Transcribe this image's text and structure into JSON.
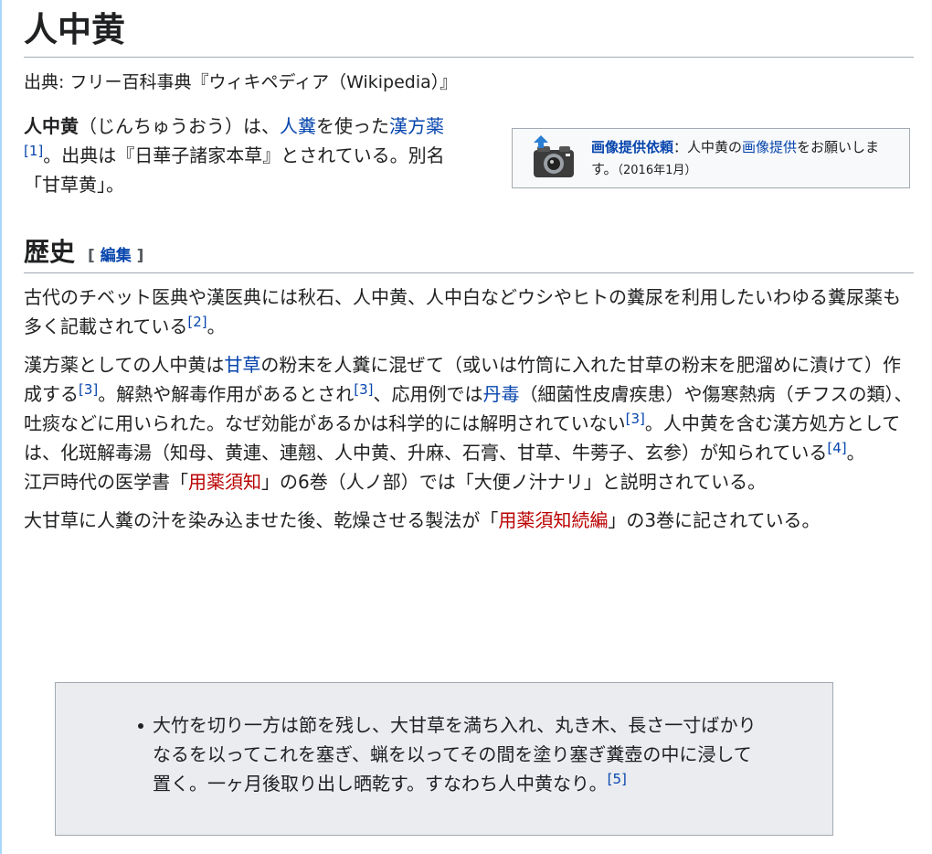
{
  "page_title": "人中黄",
  "subtitle": "出典: フリー百科事典『ウィキペディア（Wikipedia）』",
  "lead": {
    "term": "人中黄",
    "t1": "（じんちゅうおう）は、",
    "link_jinpun": "人糞",
    "t2": "を使った",
    "link_kampo": "漢方薬",
    "ref1": "[1]",
    "t3": "。出典は『日華子諸家本草』とされている。別名「甘草黄」。"
  },
  "ambox": {
    "camera_icon": "camera-upload-icon",
    "title": "画像提供依頼",
    "t1": "：人中黄の",
    "link": "画像提供",
    "t2": "をお願いします。",
    "date": "（2016年1月）"
  },
  "history": {
    "heading": "歴史",
    "edit_open": "[ ",
    "edit_label": "編集",
    "edit_close": " ]",
    "p1": {
      "text": "古代のチベット医典や漢医典には秋石、人中黄、人中白などウシやヒトの糞尿を利用したいわゆる糞尿薬も多く記載されている",
      "ref": "[2]",
      "end": "。"
    },
    "p2": {
      "a": "漢方薬としての人中黄は",
      "link_kanzo": "甘草",
      "b": "の粉末を人糞に混ぜて（或いは竹筒に入れた甘草の粉末を肥溜めに漬けて）作成する",
      "ref1": "[3]",
      "c": "。解熱や解毒作用があるとされ",
      "ref2": "[3]",
      "d": "、応用例では",
      "link_tandoku": "丹毒",
      "e": "（細菌性皮膚疾患）や傷寒熱病（チフスの類）、吐痰などに用いられた。なぜ効能があるかは科学的には解明されていない",
      "ref3": "[3]",
      "f": "。人中黄を含む漢方処方としては、化斑解毒湯（知母、黄連、連翹、人中黄、升麻、石膏、甘草、牛蒡子、玄参）が知られている",
      "ref4": "[4]",
      "g": "。"
    },
    "p3": {
      "a": "江戸時代の医学書「",
      "link": "用薬須知",
      "b": "」の6巻（人ノ部）では「大便ノ汁ナリ」と説明されている。"
    },
    "p4": {
      "a": "大甘草に人糞の汁を染み込ませた後、乾燥させる製法が「",
      "link": "用薬須知続編",
      "b": "」の3巻に記されている。"
    },
    "quote": {
      "text": "大竹を切り一方は節を残し、大甘草を満ち入れ、丸き木、長さ一寸ばかりなるを以ってこれを塞ぎ、蝋を以ってその間を塗り塞ぎ糞壺の中に浸して置く。一ヶ月後取り出し晒乾す。すなわち人中黄なり。",
      "ref": "[5]"
    }
  }
}
